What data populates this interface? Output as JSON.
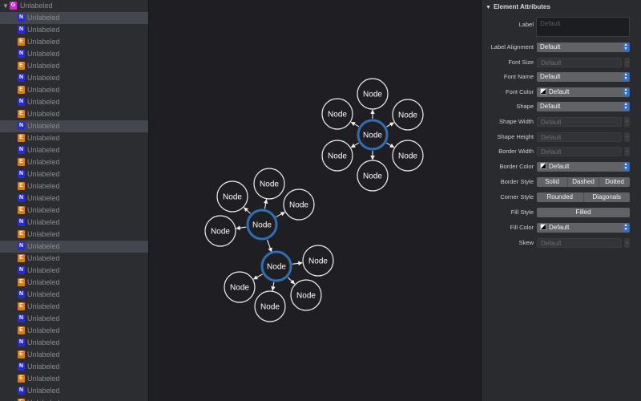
{
  "outline": {
    "root": {
      "badge": "G",
      "label": "Unlabeled"
    },
    "items": [
      {
        "badge": "N",
        "label": "Unlabeled",
        "selected": true
      },
      {
        "badge": "N",
        "label": "Unlabeled",
        "selected": false
      },
      {
        "badge": "E",
        "label": "Unlabeled",
        "selected": false
      },
      {
        "badge": "N",
        "label": "Unlabeled",
        "selected": false
      },
      {
        "badge": "E",
        "label": "Unlabeled",
        "selected": false
      },
      {
        "badge": "N",
        "label": "Unlabeled",
        "selected": false
      },
      {
        "badge": "E",
        "label": "Unlabeled",
        "selected": false
      },
      {
        "badge": "N",
        "label": "Unlabeled",
        "selected": false
      },
      {
        "badge": "E",
        "label": "Unlabeled",
        "selected": false
      },
      {
        "badge": "N",
        "label": "Unlabeled",
        "selected": true
      },
      {
        "badge": "E",
        "label": "Unlabeled",
        "selected": false
      },
      {
        "badge": "N",
        "label": "Unlabeled",
        "selected": false
      },
      {
        "badge": "E",
        "label": "Unlabeled",
        "selected": false
      },
      {
        "badge": "N",
        "label": "Unlabeled",
        "selected": false
      },
      {
        "badge": "E",
        "label": "Unlabeled",
        "selected": false
      },
      {
        "badge": "N",
        "label": "Unlabeled",
        "selected": false
      },
      {
        "badge": "E",
        "label": "Unlabeled",
        "selected": false
      },
      {
        "badge": "N",
        "label": "Unlabeled",
        "selected": false
      },
      {
        "badge": "E",
        "label": "Unlabeled",
        "selected": false
      },
      {
        "badge": "N",
        "label": "Unlabeled",
        "selected": true
      },
      {
        "badge": "E",
        "label": "Unlabeled",
        "selected": false
      },
      {
        "badge": "N",
        "label": "Unlabeled",
        "selected": false
      },
      {
        "badge": "E",
        "label": "Unlabeled",
        "selected": false
      },
      {
        "badge": "N",
        "label": "Unlabeled",
        "selected": false
      },
      {
        "badge": "E",
        "label": "Unlabeled",
        "selected": false
      },
      {
        "badge": "N",
        "label": "Unlabeled",
        "selected": false
      },
      {
        "badge": "E",
        "label": "Unlabeled",
        "selected": false
      },
      {
        "badge": "N",
        "label": "Unlabeled",
        "selected": false
      },
      {
        "badge": "E",
        "label": "Unlabeled",
        "selected": false
      },
      {
        "badge": "N",
        "label": "Unlabeled",
        "selected": false
      },
      {
        "badge": "E",
        "label": "Unlabeled",
        "selected": false
      },
      {
        "badge": "N",
        "label": "Unlabeled",
        "selected": false
      },
      {
        "badge": "E",
        "label": "Unlabeled",
        "selected": false
      }
    ]
  },
  "colors": {
    "badge_group": "#d12ad1",
    "badge_node": "#2a2ad1",
    "badge_edge": "#e07a12",
    "hub_stroke": "#2f6fb6",
    "popup_arrows": "#2f6fd6"
  },
  "graph": {
    "hub_label": "Node",
    "leaf_label": "Node"
  },
  "inspector": {
    "title": "Element Attributes",
    "label_label": "Label",
    "label_placeholder": "Default",
    "label_alignment": {
      "label": "Label Alignment",
      "value": "Default"
    },
    "font_size": {
      "label": "Font Size",
      "placeholder": "Default"
    },
    "font_name": {
      "label": "Font Name",
      "value": "Default"
    },
    "font_color": {
      "label": "Font Color",
      "value": "Default"
    },
    "shape": {
      "label": "Shape",
      "value": "Default"
    },
    "shape_width": {
      "label": "Shape Width",
      "placeholder": "Default"
    },
    "shape_height": {
      "label": "Shape Height",
      "placeholder": "Default"
    },
    "border_width": {
      "label": "Border Width",
      "placeholder": "Default"
    },
    "border_color": {
      "label": "Border Color",
      "value": "Default"
    },
    "border_style": {
      "label": "Border Style",
      "options": [
        "Solid",
        "Dashed",
        "Dotted"
      ]
    },
    "corner_style": {
      "label": "Corner Style",
      "options": [
        "Rounded",
        "Diagonals"
      ]
    },
    "fill_style": {
      "label": "Fill Style",
      "options": [
        "Filled"
      ]
    },
    "fill_color": {
      "label": "Fill Color",
      "value": "Default"
    },
    "skew": {
      "label": "Skew",
      "placeholder": "Default"
    }
  }
}
